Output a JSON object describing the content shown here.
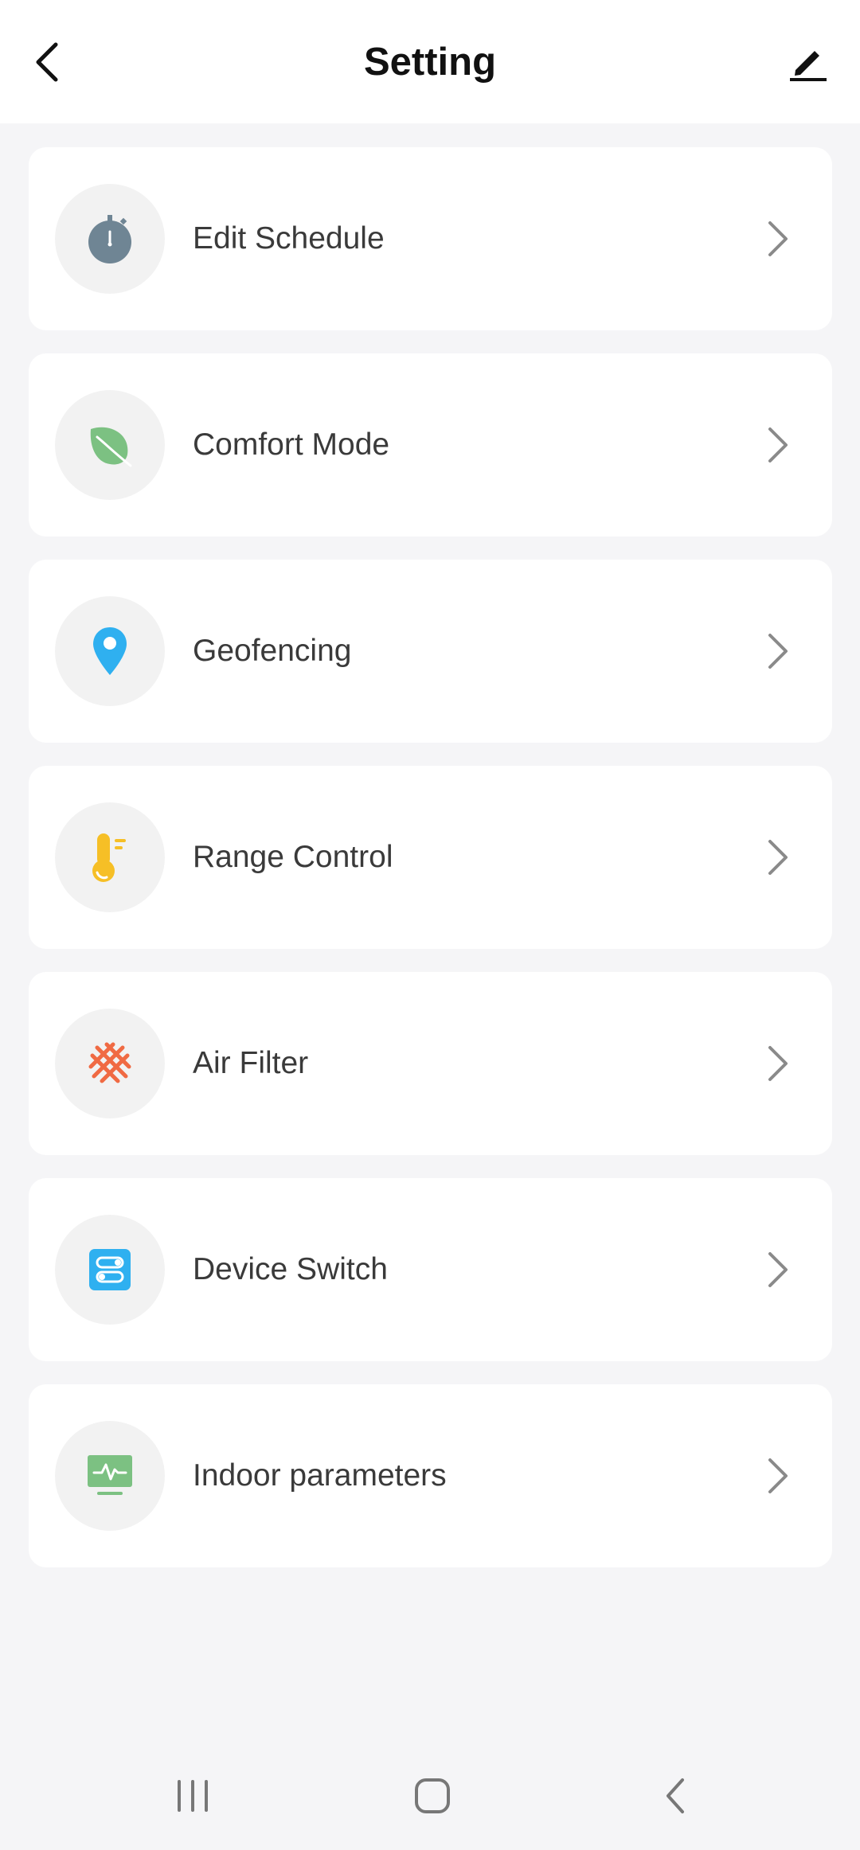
{
  "header": {
    "title": "Setting",
    "back_icon": "chevron-left-icon",
    "edit_icon": "pencil-icon"
  },
  "settings": {
    "items": [
      {
        "label": "Edit Schedule",
        "icon": "stopwatch-icon",
        "color": "#6f8594"
      },
      {
        "label": "Comfort Mode",
        "icon": "leaf-icon",
        "color": "#7cc182"
      },
      {
        "label": "Geofencing",
        "icon": "location-pin-icon",
        "color": "#2fb0f0"
      },
      {
        "label": "Range Control",
        "icon": "thermometer-icon",
        "color": "#f6bf26"
      },
      {
        "label": "Air Filter",
        "icon": "filter-mesh-icon",
        "color": "#f06a43"
      },
      {
        "label": "Device Switch",
        "icon": "toggle-switch-icon",
        "color": "#2fb0f0"
      },
      {
        "label": "Indoor parameters",
        "icon": "monitor-pulse-icon",
        "color": "#7cc182"
      }
    ]
  },
  "system_nav": {
    "recents_icon": "recents-icon",
    "home_icon": "home-icon",
    "back_icon": "back-icon"
  }
}
